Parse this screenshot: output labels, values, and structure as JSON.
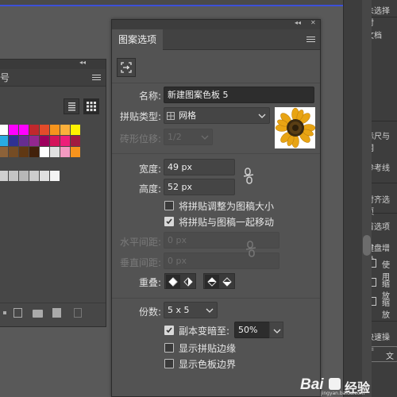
{
  "left_panel": {
    "tab_label": "号",
    "collapse_glyph": "◂◂",
    "menu_icon": "hamburger-icon",
    "swatch_colors": [
      [
        "#ffffff",
        "#ff00ff",
        "#ff00ff",
        "#c0282d",
        "#e34b2a",
        "#f7941d",
        "#fbb03b",
        "#fff200"
      ],
      [
        "#29abe2",
        "#2e3192",
        "#662d91",
        "#93278f",
        "#9e005d",
        "#d4145a",
        "#ed1e79",
        "#a01c40"
      ],
      [
        "#8c6239",
        "#754c24",
        "#603813",
        "#42210b",
        "#ffffff",
        "#e0e0e0",
        "#f49ac1",
        "#f7941d"
      ]
    ],
    "gray_colors": [
      "#d0d0d0",
      "#c4c4c4",
      "#b8b8b8",
      "#cccccc",
      "#e0e0e0",
      "#f4f4f4"
    ]
  },
  "panel": {
    "tab_label": "图案选项",
    "collapse_glyph": "◂◂",
    "close_glyph": "✕",
    "name_label": "名称:",
    "name_value": "新建图案色板 5",
    "tile_type_label": "拼贴类型:",
    "tile_type_value": "网格",
    "brick_offset_label": "砖形位移:",
    "brick_offset_value": "1/2",
    "width_label": "宽度:",
    "width_value": "49 px",
    "height_label": "高度:",
    "height_value": "52 px",
    "resize_to_art": "将拼贴调整为图稿大小",
    "move_with_art": "将拼贴与图稿一起移动",
    "h_spacing_label": "水平间距:",
    "h_spacing_value": "0 px",
    "v_spacing_label": "垂直间距:",
    "v_spacing_value": "0 px",
    "overlap_label": "重叠:",
    "copies_label": "份数:",
    "copies_value": "5 x 5",
    "dim_copies_label": "副本变暗至:",
    "dim_copies_value": "50%",
    "show_tile_edge": "显示拼贴边缘",
    "show_swatch_bounds": "显示色板边界",
    "move_with_art_checked": true,
    "dim_copies_checked": true,
    "resize_to_art_checked": false,
    "show_tile_edge_checked": false,
    "show_swatch_bounds_checked": false
  },
  "right_panel": {
    "unselected": "未选择对",
    "document": "文档",
    "rulers": "标尺与网",
    "guides": "参考线",
    "align": "对齐选项",
    "preferences": "首选项",
    "keyboard_inc": "键盘增量",
    "opt1": "使用",
    "opt2": "缩放",
    "opt3": "缩放",
    "quick_actions": "快速操作",
    "button": "文"
  },
  "watermark": {
    "brand": "Bai",
    "brand_cn": "经验",
    "sub": "jingyan.baidu.com"
  },
  "colors": {
    "accent_line": "#3c50d8",
    "panel_bg": "#535353"
  }
}
